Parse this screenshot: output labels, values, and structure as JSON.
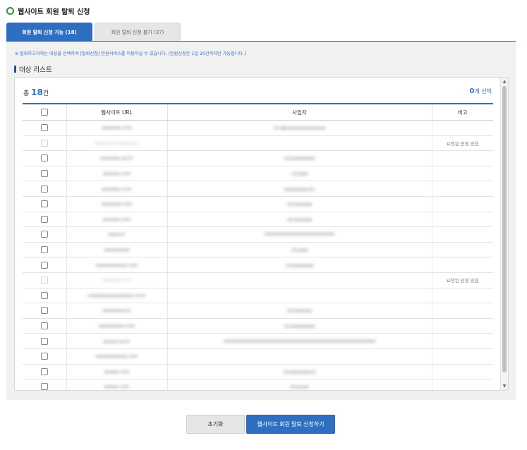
{
  "page": {
    "title": "웹사이트 회원 탈퇴 신청"
  },
  "tabs": [
    {
      "label": "회원 탈퇴 신청 가능 (18)",
      "active": true
    },
    {
      "label": "회원 탈퇴 신청 불가 (37)",
      "active": false
    }
  ],
  "notice": "※ 탈퇴하고자하는 대상을 선택하여 [탈퇴신청] 민원서비스를 이용하실 수 있습니다. (민원신청은 1일 20건까지만 가능합니다.)",
  "list": {
    "heading": "대상 리스트",
    "total_prefix": "총",
    "total_count": "18",
    "total_suffix": "건",
    "selected_count": "0",
    "selected_suffix": "개 선택",
    "columns": [
      "웹사이트 URL",
      "사업자",
      "비고"
    ],
    "rows": [
      {
        "url": "aaaaaaa.com",
        "company": "주식회사000000000000",
        "note": "",
        "disabled": false
      },
      {
        "url": "aaaa.aa.aaaaaa.aa",
        "company": "",
        "note": "요청된 민원 있음",
        "disabled": true
      },
      {
        "url": "aaaaaaa.aa.kr",
        "company": "(주)00000000",
        "note": "",
        "disabled": false
      },
      {
        "url": "aaaaaa.com",
        "company": "(주)000",
        "note": "",
        "disabled": false
      },
      {
        "url": "aaaaaa.co.kr",
        "company": "00000000(주)",
        "note": "",
        "disabled": false
      },
      {
        "url": "aaaaaaa.com",
        "company": "(주)000000",
        "note": "",
        "disabled": false
      },
      {
        "url": "aaaaaa.com",
        "company": "(주)000000",
        "note": "",
        "disabled": false
      },
      {
        "url": "aaaa.kr",
        "company": "000000000000000000000000",
        "note": "",
        "disabled": false
      },
      {
        "url": "aaaaaaaaa",
        "company": "(주)000",
        "note": "",
        "disabled": false
      },
      {
        "url": "aaaaaaaaaaa.com",
        "company": "(주)0000000",
        "note": "",
        "disabled": false
      },
      {
        "url": "aaaaaa.com",
        "company": "",
        "note": "요청된 민원 있음",
        "disabled": true
      },
      {
        "url": "aaaaaaaaaaaaaaaa.co.kr",
        "company": "",
        "note": "",
        "disabled": false
      },
      {
        "url": "aaaaaaaa.kr",
        "company": "(주)000000",
        "note": "",
        "disabled": false
      },
      {
        "url": "aaaaaaaaa.com",
        "company": "(주)00000000",
        "note": "",
        "disabled": false
      },
      {
        "url": "aaaaa.aa.kr",
        "company": "0000000000000000000000000000000000000000000000000000",
        "note": "",
        "disabled": false
      },
      {
        "url": "aaaaaaaaaaa.com",
        "company": "",
        "note": "",
        "disabled": false
      },
      {
        "url": "aaaaa.com",
        "company": "(주)000000(주)",
        "note": "",
        "disabled": false
      },
      {
        "url": "aaaaa.com",
        "company": "(주)0000",
        "note": "",
        "disabled": false
      }
    ]
  },
  "buttons": {
    "reset": "초기화",
    "submit": "웹사이트 회원 탈퇴 신청하기"
  },
  "scroll": {
    "up": "▲",
    "down": "▼"
  },
  "colors": {
    "accent": "#2e6fc2",
    "panel_bg": "#f1f1f1"
  }
}
